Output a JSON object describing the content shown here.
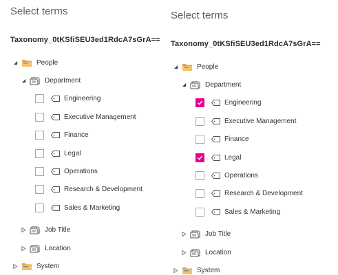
{
  "colors": {
    "checked": "#e3008c",
    "folder": "#e8a63c",
    "text": "#333333"
  },
  "left": {
    "title": "Select terms",
    "taxonomy": "Taxonomy_0tKSfiSEU3ed1RdcA7sGrA==",
    "group": {
      "label": "People",
      "expanded": true,
      "icon": "folder-icon"
    },
    "term_set": {
      "label": "Department",
      "expanded": true,
      "icon": "termset-icon"
    },
    "terms": [
      {
        "label": "Engineering",
        "checked": false,
        "icon": "tag-icon"
      },
      {
        "label": "Executive Management",
        "checked": false,
        "icon": "tag-icon"
      },
      {
        "label": "Finance",
        "checked": false,
        "icon": "tag-icon"
      },
      {
        "label": "Legal",
        "checked": false,
        "icon": "tag-icon"
      },
      {
        "label": "Operations",
        "checked": false,
        "icon": "tag-icon"
      },
      {
        "label": "Research & Development",
        "checked": false,
        "icon": "tag-icon"
      },
      {
        "label": "Sales & Marketing",
        "checked": false,
        "icon": "tag-icon"
      }
    ],
    "collapsed_sets": [
      {
        "label": "Job Title",
        "expanded": false
      },
      {
        "label": "Location",
        "expanded": false
      }
    ],
    "other_group": {
      "label": "System",
      "expanded": false
    }
  },
  "right": {
    "title": "Select terms",
    "taxonomy": "Taxonomy_0tKSfiSEU3ed1RdcA7sGrA==",
    "group": {
      "label": "People",
      "expanded": true,
      "icon": "folder-icon"
    },
    "term_set": {
      "label": "Department",
      "expanded": true,
      "icon": "termset-icon"
    },
    "terms": [
      {
        "label": "Engineering",
        "checked": true,
        "icon": "tag-icon"
      },
      {
        "label": "Executive Management",
        "checked": false,
        "icon": "tag-icon"
      },
      {
        "label": "Finance",
        "checked": false,
        "icon": "tag-icon"
      },
      {
        "label": "Legal",
        "checked": true,
        "icon": "tag-icon"
      },
      {
        "label": "Operations",
        "checked": false,
        "icon": "tag-icon"
      },
      {
        "label": "Research & Development",
        "checked": false,
        "icon": "tag-icon"
      },
      {
        "label": "Sales & Marketing",
        "checked": false,
        "icon": "tag-icon"
      }
    ],
    "collapsed_sets": [
      {
        "label": "Job Title",
        "expanded": false
      },
      {
        "label": "Location",
        "expanded": false
      }
    ],
    "other_group": {
      "label": "System",
      "expanded": false
    }
  }
}
